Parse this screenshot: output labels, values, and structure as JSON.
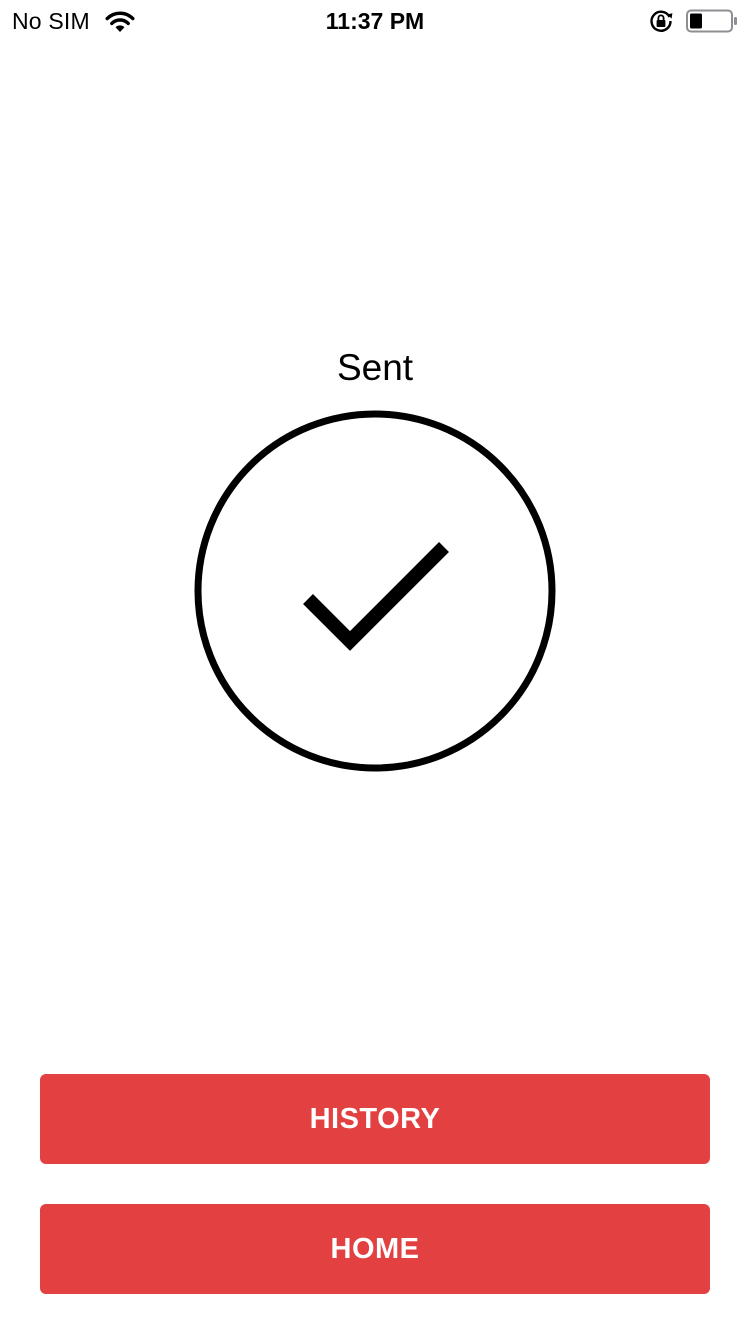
{
  "status_bar": {
    "carrier": "No SIM",
    "time": "11:37 PM",
    "battery_level": 0.3,
    "icons": [
      "wifi-icon",
      "orientation-lock-icon",
      "battery-icon"
    ]
  },
  "main": {
    "title": "Sent",
    "status_icon": "checkmark-circle-icon"
  },
  "buttons": {
    "history_label": "HISTORY",
    "home_label": "HOME"
  },
  "colors": {
    "accent": "#E24041",
    "button_text": "#FFFFFF",
    "icon": "#000000",
    "background": "#FFFFFF"
  }
}
